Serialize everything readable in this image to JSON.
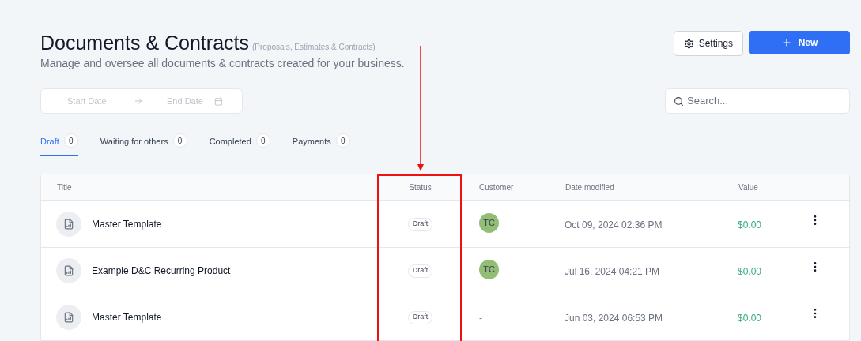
{
  "header": {
    "title": "Documents & Contracts",
    "subtitle": "(Proposals, Estimates & Contracts)",
    "description": "Manage and oversee all documents & contracts created for your business."
  },
  "actions": {
    "settings": "Settings",
    "new": "New"
  },
  "date_range": {
    "start_placeholder": "Start Date",
    "end_placeholder": "End Date"
  },
  "search": {
    "placeholder": "Search..."
  },
  "tabs": [
    {
      "label": "Draft",
      "count": "0",
      "selected": true
    },
    {
      "label": "Waiting for others",
      "count": "0",
      "selected": false
    },
    {
      "label": "Completed",
      "count": "0",
      "selected": false
    },
    {
      "label": "Payments",
      "count": "0",
      "selected": false
    }
  ],
  "table": {
    "columns": [
      "Title",
      "Status",
      "Customer",
      "Date modified",
      "Value"
    ],
    "rows": [
      {
        "title": "Master Template",
        "status": "Draft",
        "customer": {
          "kind": "avatar",
          "text": "TC"
        },
        "date": "Oct 09, 2024 02:36 PM",
        "value": "$0.00"
      },
      {
        "title": "Example D&C Recurring Product",
        "status": "Draft",
        "customer": {
          "kind": "avatar",
          "text": "TC"
        },
        "date": "Jul 16, 2024 04:21 PM",
        "value": "$0.00"
      },
      {
        "title": "Master Template",
        "status": "Draft",
        "customer": {
          "kind": "text",
          "text": "-"
        },
        "date": "Jun 03, 2024 06:53 PM",
        "value": "$0.00"
      }
    ]
  }
}
